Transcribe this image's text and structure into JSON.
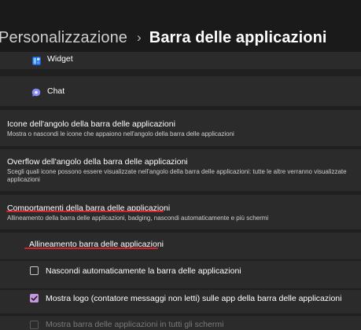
{
  "breadcrumb": {
    "parent": "Personalizzazione",
    "separator": "›",
    "current": "Barra delle applicazioni"
  },
  "taskbar_items": [
    {
      "label": "Widget",
      "icon": "widget-icon"
    },
    {
      "label": "Chat",
      "icon": "chat-icon"
    }
  ],
  "corner_icons": {
    "title": "Icone dell'angolo della barra delle applicazioni",
    "subtitle": "Mostra o nascondi le icone che appaiono nell'angolo della barra delle applicazioni"
  },
  "corner_overflow": {
    "title": "Overflow dell'angolo della barra delle applicazioni",
    "subtitle_line1": "Scegli quali icone possono essere visualizzate nell'angolo della barra delle applicazioni: tutte le altre verranno visualizzate",
    "subtitle_line2": "applicazioni"
  },
  "behaviors": {
    "title": "Comportamenti della barra delle applicazioni",
    "subtitle": "Allineamento della barra delle applicazioni, badging, nascondi automaticamente e più schermi",
    "alignment_label": "Allineamento barra delle applicazioni",
    "options": [
      {
        "label": "Nascondi automaticamente la barra delle applicazioni",
        "checked": false,
        "disabled": false
      },
      {
        "label": "Mostra logo (contatore messaggi non letti) sulle app della barra delle applicazioni",
        "checked": true,
        "disabled": false
      },
      {
        "label": "Mostra barra delle applicazioni in tutti gli schermi",
        "checked": false,
        "disabled": true
      }
    ]
  },
  "colors": {
    "accent": "#c597e0",
    "annotation_underline": "#d6202c"
  }
}
